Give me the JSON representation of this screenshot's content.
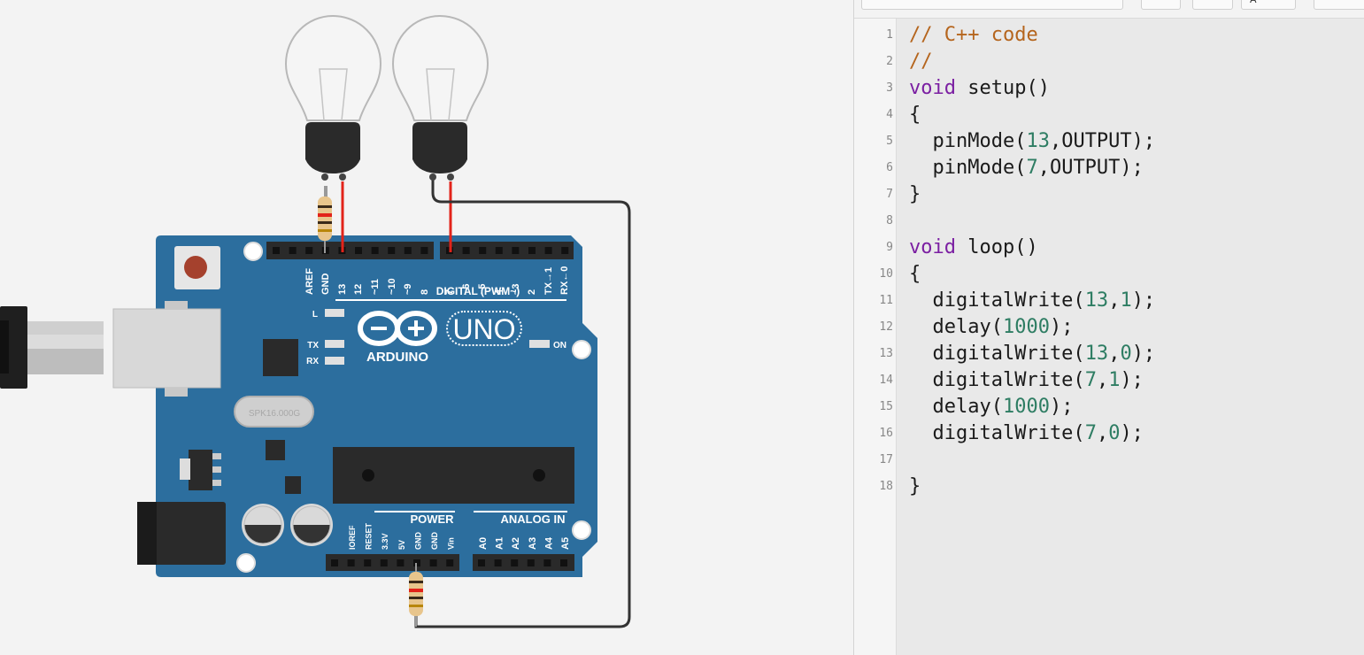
{
  "board": {
    "logo_text": "ARDUINO",
    "model": "UNO",
    "section_digital": "DIGITAL (PWM~)",
    "section_power": "POWER",
    "section_analog": "ANALOG IN",
    "led_l": "L",
    "led_tx": "TX",
    "led_rx": "RX",
    "led_on": "ON",
    "crystal": "SPK16.000G",
    "top_pins": [
      "AREF",
      "GND",
      "13",
      "12",
      "~11",
      "~10",
      "~9",
      "8",
      "7",
      "~6",
      "~5",
      "4",
      "~3",
      "2",
      "TX→1",
      "RX←0"
    ],
    "power_pins": [
      "IOREF",
      "RESET",
      "3.3V",
      "5V",
      "GND",
      "GND",
      "Vin"
    ],
    "analog_pins": [
      "A0",
      "A1",
      "A2",
      "A3",
      "A4",
      "A5"
    ]
  },
  "components": [
    {
      "type": "lightbulb",
      "name": "bulb-left"
    },
    {
      "type": "lightbulb",
      "name": "bulb-right"
    },
    {
      "type": "resistor",
      "name": "resistor-top"
    },
    {
      "type": "resistor",
      "name": "resistor-bottom"
    },
    {
      "type": "usb-cable",
      "name": "usb-cable"
    }
  ],
  "colors": {
    "board": "#2c6e9e",
    "wire_red": "#e2231a",
    "wire_black": "#333333",
    "comment": "#b5651d",
    "keyword": "#7b1fa2",
    "number": "#2e7d63"
  },
  "editor": {
    "lines": [
      {
        "n": "1",
        "tokens": [
          {
            "t": "// C++ code",
            "c": "cm"
          }
        ]
      },
      {
        "n": "2",
        "tokens": [
          {
            "t": "//",
            "c": "cm"
          }
        ]
      },
      {
        "n": "3",
        "tokens": [
          {
            "t": "void",
            "c": "kw"
          },
          {
            "t": " setup()",
            "c": "pl"
          }
        ]
      },
      {
        "n": "4",
        "tokens": [
          {
            "t": "{",
            "c": "pl"
          }
        ]
      },
      {
        "n": "5",
        "tokens": [
          {
            "t": "  pinMode(",
            "c": "pl"
          },
          {
            "t": "13",
            "c": "nm"
          },
          {
            "t": ",OUTPUT);",
            "c": "pl"
          }
        ]
      },
      {
        "n": "6",
        "tokens": [
          {
            "t": "  pinMode(",
            "c": "pl"
          },
          {
            "t": "7",
            "c": "nm"
          },
          {
            "t": ",OUTPUT);",
            "c": "pl"
          }
        ]
      },
      {
        "n": "7",
        "tokens": [
          {
            "t": "}",
            "c": "pl"
          }
        ]
      },
      {
        "n": "8",
        "tokens": []
      },
      {
        "n": "9",
        "tokens": [
          {
            "t": "void",
            "c": "kw"
          },
          {
            "t": " loop()",
            "c": "pl"
          }
        ]
      },
      {
        "n": "10",
        "tokens": [
          {
            "t": "{",
            "c": "pl"
          }
        ]
      },
      {
        "n": "11",
        "tokens": [
          {
            "t": "  digitalWrite(",
            "c": "pl"
          },
          {
            "t": "13",
            "c": "nm"
          },
          {
            "t": ",",
            "c": "pl"
          },
          {
            "t": "1",
            "c": "nm"
          },
          {
            "t": ");",
            "c": "pl"
          }
        ]
      },
      {
        "n": "12",
        "tokens": [
          {
            "t": "  delay(",
            "c": "pl"
          },
          {
            "t": "1000",
            "c": "nm"
          },
          {
            "t": ");",
            "c": "pl"
          }
        ]
      },
      {
        "n": "13",
        "tokens": [
          {
            "t": "  digitalWrite(",
            "c": "pl"
          },
          {
            "t": "13",
            "c": "nm"
          },
          {
            "t": ",",
            "c": "pl"
          },
          {
            "t": "0",
            "c": "nm"
          },
          {
            "t": ");",
            "c": "pl"
          }
        ]
      },
      {
        "n": "14",
        "tokens": [
          {
            "t": "  digitalWrite(",
            "c": "pl"
          },
          {
            "t": "7",
            "c": "nm"
          },
          {
            "t": ",",
            "c": "pl"
          },
          {
            "t": "1",
            "c": "nm"
          },
          {
            "t": ");",
            "c": "pl"
          }
        ]
      },
      {
        "n": "15",
        "tokens": [
          {
            "t": "  delay(",
            "c": "pl"
          },
          {
            "t": "1000",
            "c": "nm"
          },
          {
            "t": ");",
            "c": "pl"
          }
        ]
      },
      {
        "n": "16",
        "tokens": [
          {
            "t": "  digitalWrite(",
            "c": "pl"
          },
          {
            "t": "7",
            "c": "nm"
          },
          {
            "t": ",",
            "c": "pl"
          },
          {
            "t": "0",
            "c": "nm"
          },
          {
            "t": ");",
            "c": "pl"
          }
        ]
      },
      {
        "n": "17",
        "tokens": []
      },
      {
        "n": "18",
        "tokens": [
          {
            "t": "}",
            "c": "pl"
          }
        ]
      }
    ]
  }
}
